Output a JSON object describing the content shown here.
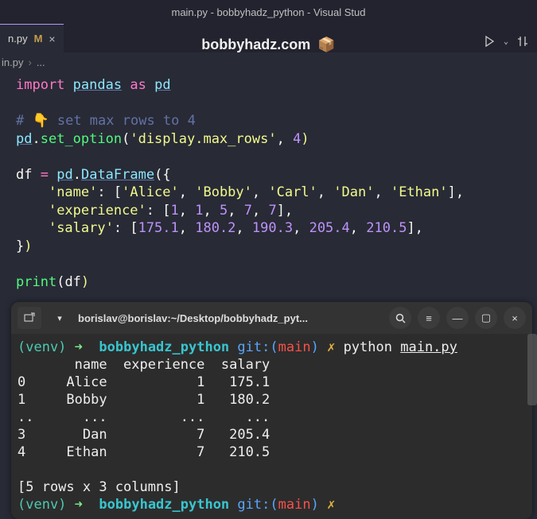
{
  "window": {
    "title": "main.py - bobbyhadz_python - Visual Stud"
  },
  "tab": {
    "filename": "n.py",
    "modified_marker": "M"
  },
  "watermark": {
    "text": "bobbyhadz.com",
    "emoji": "📦"
  },
  "breadcrumb": {
    "file": "in.py",
    "rest": "..."
  },
  "code": {
    "l1": {
      "import": "import",
      "pandas": "pandas",
      "as": "as",
      "pd": "pd"
    },
    "l3_comment": "# 👇 set max rows to 4",
    "l4": {
      "pd": "pd",
      "set_option": "set_option",
      "arg": "'display.max_rows'",
      "num": "4"
    },
    "l6": {
      "df": "df",
      "eq": "=",
      "pd": "pd",
      "DataFrame": "DataFrame"
    },
    "l7": {
      "key": "'name'",
      "v1": "'Alice'",
      "v2": "'Bobby'",
      "v3": "'Carl'",
      "v4": "'Dan'",
      "v5": "'Ethan'"
    },
    "l8": {
      "key": "'experience'",
      "n1": "1",
      "n2": "1",
      "n3": "5",
      "n4": "7",
      "n5": "7"
    },
    "l9": {
      "key": "'salary'",
      "n1": "175.1",
      "n2": "180.2",
      "n3": "190.3",
      "n4": "205.4",
      "n5": "210.5"
    },
    "l12": {
      "print": "print",
      "arg": "df"
    }
  },
  "terminal": {
    "title": "borislav@borislav:~/Desktop/bobbyhadz_pyt...",
    "prompt": {
      "venv": "(venv)",
      "arrow": "➜",
      "dir": "bobbyhadz_python",
      "git": "git:(",
      "branch": "main",
      "gitclose": ")",
      "dirty": "✗",
      "cmd": "python",
      "file": "main.py"
    },
    "out_header": "       name  experience  salary",
    "out_rows": [
      "0     Alice           1   175.1",
      "1     Bobby           1   180.2",
      "..      ...         ...     ...",
      "3       Dan           7   205.4",
      "4     Ethan           7   210.5"
    ],
    "out_footer": "[5 rows x 3 columns]"
  },
  "chart_data": {
    "type": "table",
    "title": "DataFrame output",
    "columns": [
      "",
      "name",
      "experience",
      "salary"
    ],
    "rows": [
      [
        "0",
        "Alice",
        1,
        175.1
      ],
      [
        "1",
        "Bobby",
        1,
        180.2
      ],
      [
        "..",
        "...",
        "...",
        "..."
      ],
      [
        "3",
        "Dan",
        7,
        205.4
      ],
      [
        "4",
        "Ethan",
        7,
        210.5
      ]
    ],
    "footer": "[5 rows x 3 columns]"
  }
}
